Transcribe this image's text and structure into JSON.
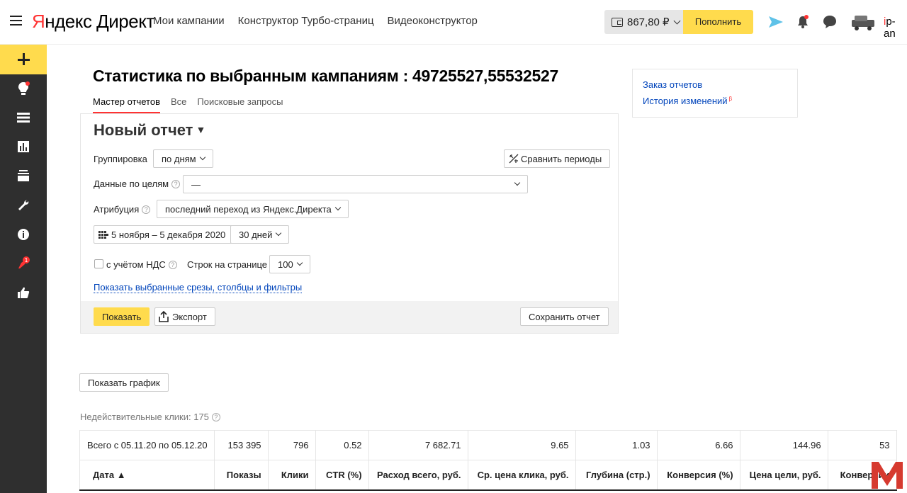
{
  "header": {
    "logo_yandex": "Яндекс",
    "logo_direct": "Директ",
    "nav": [
      "Мои кампании",
      "Конструктор Турбо-страниц",
      "Видеоконструктор"
    ],
    "balance": "867,80 ₽",
    "topup_label": "Пополнить",
    "login_first": "i",
    "login_rest": "p-an"
  },
  "page": {
    "title": "Статистика по выбранным кампаниям : 49725527,55532527",
    "tabs": [
      "Мастер отчетов",
      "Все",
      "Поисковые запросы"
    ]
  },
  "report": {
    "name": "Новый отчет",
    "grouping_label": "Группировка",
    "grouping_value": "по дням",
    "compare_label": "Сравнить периоды",
    "goals_label": "Данные по целям",
    "goals_value": "—",
    "attribution_label": "Атрибуция",
    "attribution_value": "последний переход из Яндекс.Директа",
    "date_range": "5 ноября – 5 декабря 2020",
    "period_value": "30 дней",
    "vat_label": "с учётом НДС",
    "rows_label": "Строк на странице",
    "rows_value": "100",
    "show_filters_link": "Показать выбранные срезы, столбцы и фильтры",
    "show_button": "Показать",
    "export_button": "Экспорт",
    "save_button": "Сохранить отчет"
  },
  "side_links": {
    "order_reports": "Заказ отчетов",
    "history": "История изменений",
    "history_badge": "β"
  },
  "show_chart_button": "Показать график",
  "invalid_clicks": "Недействительные клики: 175",
  "table": {
    "total_row": [
      "Всего с 05.11.20 по 05.12.20",
      "153 395",
      "796",
      "0.52",
      "7 682.71",
      "9.65",
      "1.03",
      "6.66",
      "144.96",
      "53"
    ],
    "headers": [
      "Дата ▲",
      "Показы",
      "Клики",
      "CTR (%)",
      "Расход всего, руб.",
      "Ср. цена клика, руб.",
      "Глубина (стр.)",
      "Конверсия (%)",
      "Цена цели, руб.",
      "Конверсии"
    ]
  },
  "colors": {
    "accent_yellow": "#ffdb4d",
    "sidebar_bg": "#2f2f2f",
    "link_blue": "#0044bb",
    "brand_red": "#ff3333"
  }
}
